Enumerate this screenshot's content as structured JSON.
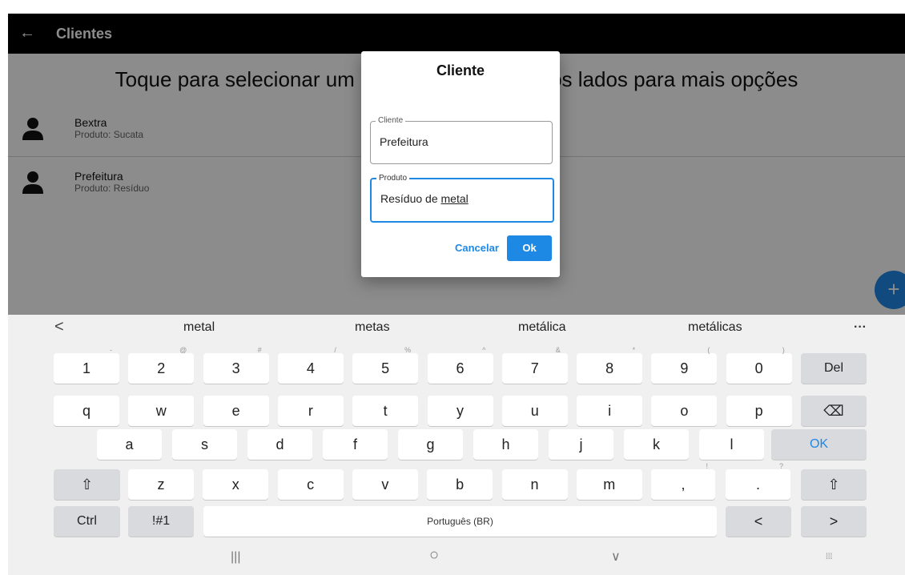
{
  "app_bar": {
    "back_icon": "arrow-left-icon",
    "title": "Clientes"
  },
  "content": {
    "hint": "Toque para selecionar um cliente, deslize para os lados para mais opções",
    "list": [
      {
        "name": "Bextra",
        "subtitle": "Produto: Sucata",
        "icon": "person-icon"
      },
      {
        "name": "Prefeitura",
        "subtitle": "Produto: Resíduo",
        "icon": "person-icon"
      }
    ],
    "fab_label": "+"
  },
  "dialog": {
    "title": "Cliente",
    "cliente_label": "Cliente",
    "cliente_value": "Prefeitura",
    "produto_label": "Produto",
    "produto_value_prefix": "Resíduo de ",
    "produto_value_word": "metal",
    "cancel_label": "Cancelar",
    "ok_label": "Ok"
  },
  "keyboard": {
    "suggestion_prev": "<",
    "suggestions": [
      "metal",
      "metas",
      "metálica",
      "metálicas"
    ],
    "suggestion_more": "···",
    "row1": [
      {
        "key": "1",
        "sub": "-"
      },
      {
        "key": "2",
        "sub": "@"
      },
      {
        "key": "3",
        "sub": "#"
      },
      {
        "key": "4",
        "sub": "/"
      },
      {
        "key": "5",
        "sub": "%"
      },
      {
        "key": "6",
        "sub": "^"
      },
      {
        "key": "7",
        "sub": "&"
      },
      {
        "key": "8",
        "sub": "*"
      },
      {
        "key": "9",
        "sub": "("
      },
      {
        "key": "0",
        "sub": ")"
      }
    ],
    "del_label": "Del",
    "row2": [
      "q",
      "w",
      "e",
      "r",
      "t",
      "y",
      "u",
      "i",
      "o",
      "p"
    ],
    "backspace_icon": "⌫",
    "row3": [
      "a",
      "s",
      "d",
      "f",
      "g",
      "h",
      "j",
      "k",
      "l"
    ],
    "ok_key_label": "OK",
    "shift_icon": "⇧",
    "row4": [
      "z",
      "x",
      "c",
      "v",
      "b",
      "n",
      "m"
    ],
    "comma_key": ",",
    "comma_sub": "!",
    "period_key": ".",
    "period_sub": "?",
    "ctrl_label": "Ctrl",
    "symbols_label": "!#1",
    "space_label": "Português (BR)",
    "left_arrow": "<",
    "right_arrow": ">"
  },
  "navbar": {
    "recents": "|||",
    "home": "○",
    "back": "∨",
    "keyboard_switch": "⁞⁞⁞"
  }
}
